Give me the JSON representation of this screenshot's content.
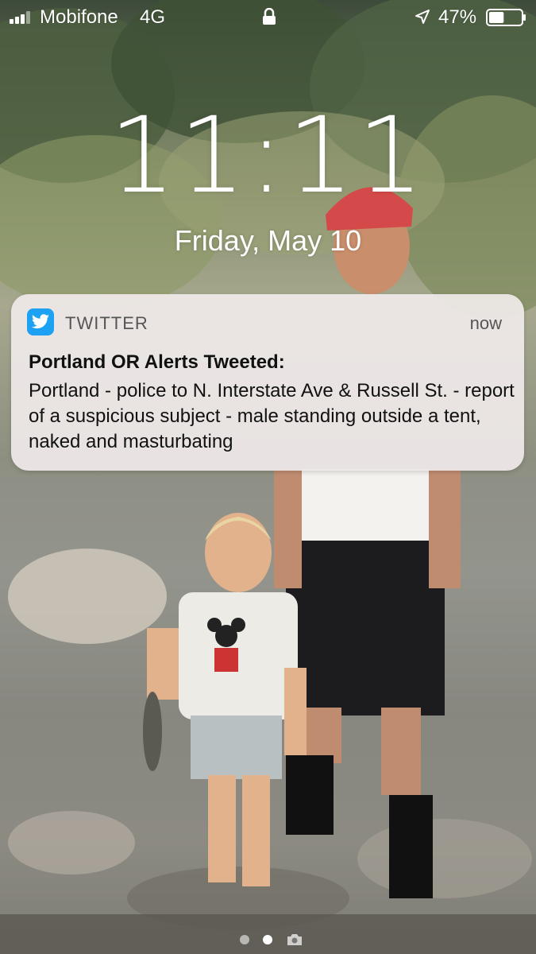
{
  "status_bar": {
    "carrier": "Mobifone",
    "network": "4G",
    "battery_percent": "47%",
    "battery_level": 0.47,
    "signal_bars_filled": 3,
    "signal_bars_total": 4
  },
  "lock_screen": {
    "time": "11:11",
    "date": "Friday, May 10"
  },
  "notification": {
    "app_name": "TWITTER",
    "time": "now",
    "title": "Portland OR Alerts Tweeted:",
    "body": "Portland - police to N. Interstate Ave & Russell St. - report of a suspicious subject - male standing outside a tent, naked and masturbating",
    "app_icon": "twitter-bird-icon",
    "accent_color": "#1da1f2"
  },
  "page_indicator": {
    "pages": 2,
    "active_index": 1,
    "camera_icon": "camera-icon"
  }
}
